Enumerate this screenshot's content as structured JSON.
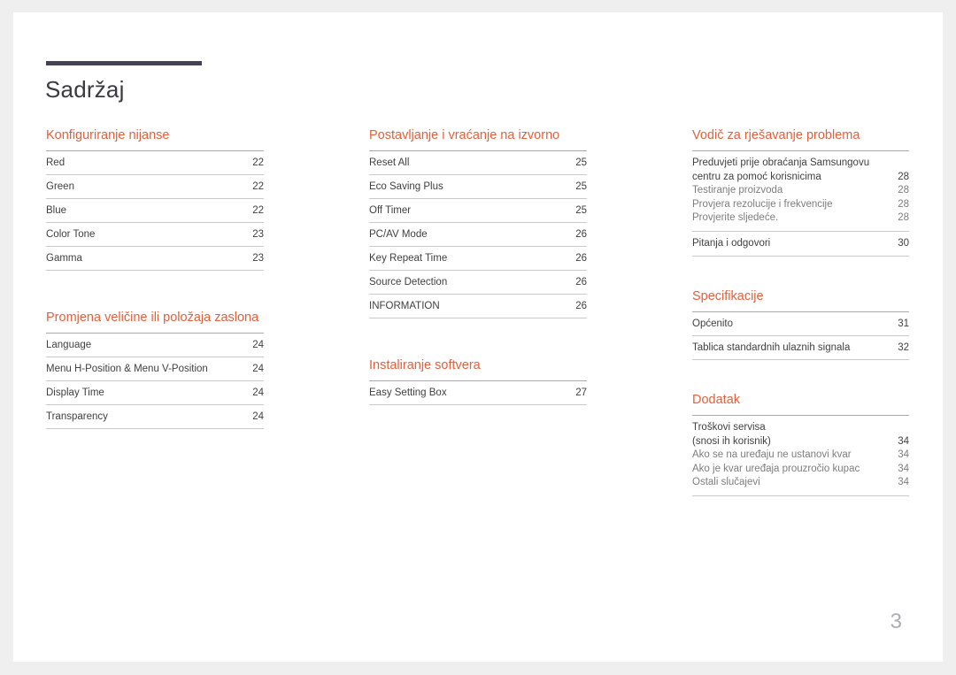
{
  "document": {
    "title": "Sadržaj",
    "page_number": "3",
    "accent_color": "#e2603c",
    "bar_color": "#454258"
  },
  "columns": [
    {
      "sections": [
        {
          "title": "Konfiguriranje nijanse",
          "entries": [
            {
              "label": "Red",
              "page": "22"
            },
            {
              "label": "Green",
              "page": "22"
            },
            {
              "label": "Blue",
              "page": "22"
            },
            {
              "label": "Color Tone",
              "page": "23"
            },
            {
              "label": "Gamma",
              "page": "23"
            }
          ]
        },
        {
          "title": "Promjena veličine ili položaja zaslona",
          "entries": [
            {
              "label": "Language",
              "page": "24"
            },
            {
              "label": "Menu H-Position & Menu V-Position",
              "page": "24"
            },
            {
              "label": "Display Time",
              "page": "24"
            },
            {
              "label": "Transparency",
              "page": "24"
            }
          ]
        }
      ]
    },
    {
      "sections": [
        {
          "title": "Postavljanje i vraćanje na izvorno",
          "entries": [
            {
              "label": "Reset All",
              "page": "25"
            },
            {
              "label": "Eco Saving Plus",
              "page": "25"
            },
            {
              "label": "Off Timer",
              "page": "25"
            },
            {
              "label": "PC/AV Mode",
              "page": "26"
            },
            {
              "label": "Key Repeat Time",
              "page": "26"
            },
            {
              "label": "Source Detection",
              "page": "26"
            },
            {
              "label": "INFORMATION",
              "page": "26"
            }
          ]
        },
        {
          "title": "Instaliranje softvera",
          "entries": [
            {
              "label": "Easy Setting Box",
              "page": "27"
            }
          ]
        }
      ]
    },
    {
      "sections": [
        {
          "title": "Vodič za rješavanje problema",
          "groups": [
            {
              "rows": [
                {
                  "label": "Preduvjeti prije obraćanja Samsungovu",
                  "page": "",
                  "sub": false
                },
                {
                  "label": "centru za pomoć korisnicima",
                  "page": "28",
                  "sub": false
                },
                {
                  "label": "Testiranje proizvoda",
                  "page": "28",
                  "sub": true
                },
                {
                  "label": "Provjera rezolucije i frekvencije",
                  "page": "28",
                  "sub": true
                },
                {
                  "label": "Provjerite sljedeće.",
                  "page": "28",
                  "sub": true
                }
              ]
            },
            {
              "rows": [
                {
                  "label": "Pitanja i odgovori",
                  "page": "30",
                  "sub": false
                }
              ]
            }
          ]
        },
        {
          "title": "Specifikacije",
          "entries": [
            {
              "label": "Općenito",
              "page": "31"
            },
            {
              "label": "Tablica standardnih ulaznih signala",
              "page": "32"
            }
          ]
        },
        {
          "title": "Dodatak",
          "groups": [
            {
              "rows": [
                {
                  "label": "Troškovi servisa",
                  "page": "",
                  "sub": false
                },
                {
                  "label": "(snosi ih korisnik)",
                  "page": "34",
                  "sub": false
                },
                {
                  "label": "Ako se na uređaju ne ustanovi kvar",
                  "page": "34",
                  "sub": true
                },
                {
                  "label": "Ako je kvar uređaja prouzročio kupac",
                  "page": "34",
                  "sub": true
                },
                {
                  "label": "Ostali slučajevi",
                  "page": "34",
                  "sub": true
                }
              ]
            }
          ]
        }
      ]
    }
  ]
}
